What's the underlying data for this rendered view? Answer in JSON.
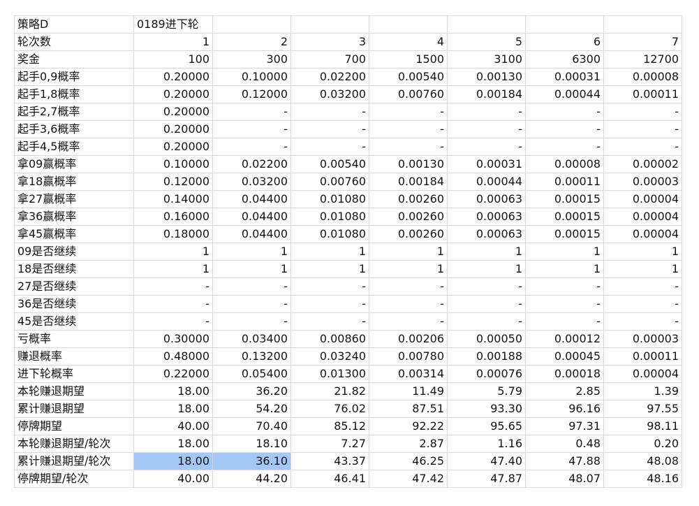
{
  "sheet": {
    "highlight_row": 25,
    "highlight_cols": [
      1,
      2
    ],
    "rows": [
      [
        "策略D",
        "0189进下轮",
        "",
        "",
        "",
        "",
        "",
        ""
      ],
      [
        "轮次数",
        "1",
        "2",
        "3",
        "4",
        "5",
        "6",
        "7"
      ],
      [
        "奖金",
        "100",
        "300",
        "700",
        "1500",
        "3100",
        "6300",
        "12700"
      ],
      [
        "起手0,9概率",
        "0.20000",
        "0.10000",
        "0.02200",
        "0.00540",
        "0.00130",
        "0.00031",
        "0.00008"
      ],
      [
        "起手1,8概率",
        "0.20000",
        "0.12000",
        "0.03200",
        "0.00760",
        "0.00184",
        "0.00044",
        "0.00011"
      ],
      [
        "起手2,7概率",
        "0.20000",
        "-",
        "-",
        "-",
        "-",
        "-",
        "-"
      ],
      [
        "起手3,6概率",
        "0.20000",
        "-",
        "-",
        "-",
        "-",
        "-",
        "-"
      ],
      [
        "起手4,5概率",
        "0.20000",
        "-",
        "-",
        "-",
        "-",
        "-",
        "-"
      ],
      [
        "拿09赢概率",
        "0.10000",
        "0.02200",
        "0.00540",
        "0.00130",
        "0.00031",
        "0.00008",
        "0.00002"
      ],
      [
        "拿18赢概率",
        "0.12000",
        "0.03200",
        "0.00760",
        "0.00184",
        "0.00044",
        "0.00011",
        "0.00003"
      ],
      [
        "拿27赢概率",
        "0.14000",
        "0.04400",
        "0.01080",
        "0.00260",
        "0.00063",
        "0.00015",
        "0.00004"
      ],
      [
        "拿36赢概率",
        "0.16000",
        "0.04400",
        "0.01080",
        "0.00260",
        "0.00063",
        "0.00015",
        "0.00004"
      ],
      [
        "拿45赢概率",
        "0.18000",
        "0.04400",
        "0.01080",
        "0.00260",
        "0.00063",
        "0.00015",
        "0.00004"
      ],
      [
        "09是否继续",
        "1",
        "1",
        "1",
        "1",
        "1",
        "1",
        "1"
      ],
      [
        "18是否继续",
        "1",
        "1",
        "1",
        "1",
        "1",
        "1",
        "1"
      ],
      [
        "27是否继续",
        "-",
        "-",
        "-",
        "-",
        "-",
        "-",
        "-"
      ],
      [
        "36是否继续",
        "-",
        "-",
        "-",
        "-",
        "-",
        "-",
        "-"
      ],
      [
        "45是否继续",
        "-",
        "-",
        "-",
        "-",
        "-",
        "-",
        "-"
      ],
      [
        "亏概率",
        "0.30000",
        "0.03400",
        "0.00860",
        "0.00206",
        "0.00050",
        "0.00012",
        "0.00003"
      ],
      [
        "赚退概率",
        "0.48000",
        "0.13200",
        "0.03240",
        "0.00780",
        "0.00188",
        "0.00045",
        "0.00011"
      ],
      [
        "进下轮概率",
        "0.22000",
        "0.05400",
        "0.01300",
        "0.00314",
        "0.00076",
        "0.00018",
        "0.00004"
      ],
      [
        "本轮赚退期望",
        "18.00",
        "36.20",
        "21.82",
        "11.49",
        "5.79",
        "2.85",
        "1.39"
      ],
      [
        "累计赚退期望",
        "18.00",
        "54.20",
        "76.02",
        "87.51",
        "93.30",
        "96.16",
        "97.55"
      ],
      [
        "停牌期望",
        "40.00",
        "70.40",
        "85.12",
        "92.22",
        "95.65",
        "97.31",
        "98.11"
      ],
      [
        "本轮赚退期望/轮次",
        "18.00",
        "18.10",
        "7.27",
        "2.87",
        "1.16",
        "0.48",
        "0.20"
      ],
      [
        "累计赚退期望/轮次",
        "18.00",
        "36.10",
        "43.37",
        "46.25",
        "47.40",
        "47.88",
        "48.08"
      ],
      [
        "停牌期望/轮次",
        "40.00",
        "44.20",
        "46.41",
        "47.42",
        "47.87",
        "48.07",
        "48.16"
      ]
    ]
  }
}
